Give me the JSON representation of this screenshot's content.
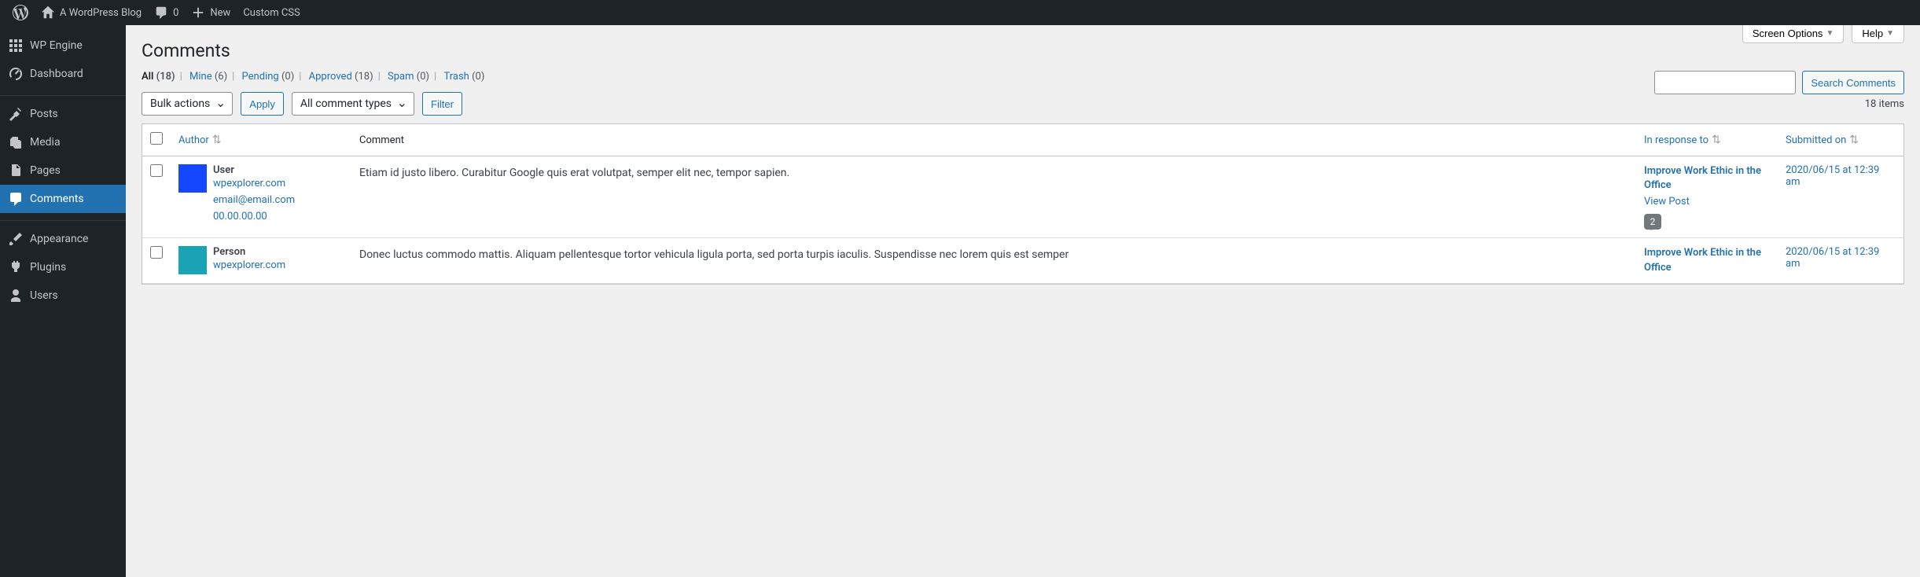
{
  "adminbar": {
    "site_name": "A WordPress Blog",
    "comment_count": "0",
    "new_label": "New",
    "custom_css_label": "Custom CSS"
  },
  "sidebar": {
    "items": [
      {
        "label": "WP Engine",
        "icon": "wpengine"
      },
      {
        "label": "Dashboard",
        "icon": "dashboard"
      },
      {
        "label": "Posts",
        "icon": "pin"
      },
      {
        "label": "Media",
        "icon": "media"
      },
      {
        "label": "Pages",
        "icon": "page"
      },
      {
        "label": "Comments",
        "icon": "comment",
        "current": true
      },
      {
        "label": "Appearance",
        "icon": "brush"
      },
      {
        "label": "Plugins",
        "icon": "plug"
      },
      {
        "label": "Users",
        "icon": "user"
      }
    ]
  },
  "screen_options_label": "Screen Options",
  "help_label": "Help",
  "page_title": "Comments",
  "filters": [
    {
      "label": "All",
      "count": "(18)",
      "current": true
    },
    {
      "label": "Mine",
      "count": "(6)"
    },
    {
      "label": "Pending",
      "count": "(0)"
    },
    {
      "label": "Approved",
      "count": "(18)"
    },
    {
      "label": "Spam",
      "count": "(0)"
    },
    {
      "label": "Trash",
      "count": "(0)"
    }
  ],
  "bulk_actions_label": "Bulk actions",
  "apply_label": "Apply",
  "comment_type_label": "All comment types",
  "filter_btn_label": "Filter",
  "search_btn_label": "Search Comments",
  "items_count": "18 items",
  "table": {
    "headers": {
      "author": "Author",
      "comment": "Comment",
      "response": "In response to",
      "date": "Submitted on"
    },
    "rows": [
      {
        "author_name": "User",
        "author_site": "wpexplorer.com",
        "author_email": "email@email.com",
        "author_ip": "00.00.00.00",
        "avatar_class": "blue",
        "comment": "Etiam id justo libero. Curabitur Google quis erat volutpat, semper elit nec, tempor sapien.",
        "response_title": "Improve Work Ethic in the Office",
        "view_post": "View Post",
        "bubble_count": "2",
        "date": "2020/06/15 at 12:39 am"
      },
      {
        "author_name": "Person",
        "author_site": "wpexplorer.com",
        "author_email": "",
        "author_ip": "",
        "avatar_class": "teal",
        "comment": "Donec luctus commodo mattis. Aliquam pellentesque tortor vehicula ligula porta, sed porta turpis iaculis. Suspendisse nec lorem quis est semper",
        "response_title": "Improve Work Ethic in the Office",
        "view_post": "",
        "bubble_count": "",
        "date": "2020/06/15 at 12:39 am"
      }
    ]
  }
}
